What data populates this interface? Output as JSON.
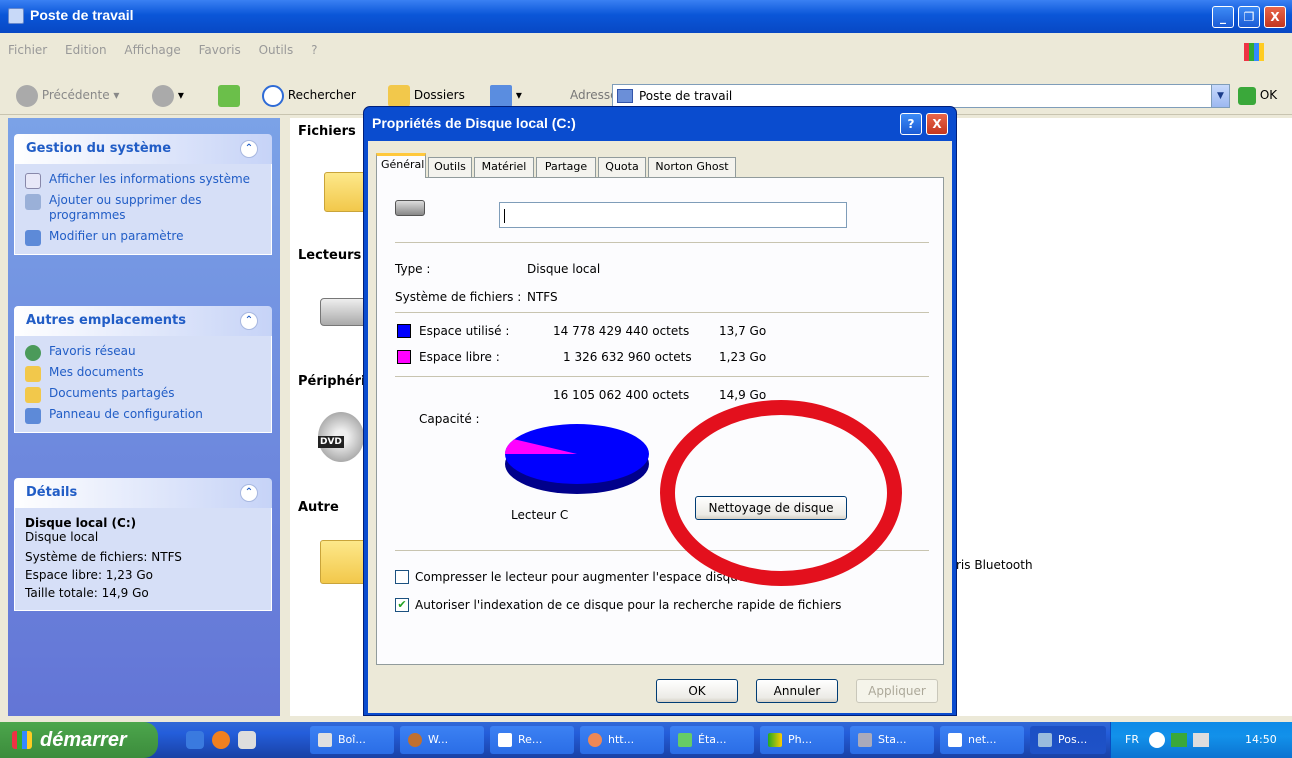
{
  "window": {
    "title": "Poste de travail",
    "minimize": "_",
    "restore": "❐",
    "close": "X"
  },
  "menu": [
    "Fichier",
    "Edition",
    "Affichage",
    "Favoris",
    "Outils",
    "?"
  ],
  "toolbar": {
    "back": "Précédente",
    "search": "Rechercher",
    "folders": "Dossiers",
    "address_label": "Adresse",
    "address_value": "Poste de travail",
    "go": "OK"
  },
  "left_panel": {
    "system": {
      "title": "Gestion du système",
      "items": [
        "Afficher les informations système",
        "Ajouter ou supprimer des programmes",
        "Modifier un paramètre"
      ]
    },
    "places": {
      "title": "Autres emplacements",
      "items": [
        "Favoris réseau",
        "Mes documents",
        "Documents partagés",
        "Panneau de configuration"
      ]
    },
    "details": {
      "title": "Détails",
      "name": "Disque local (C:)",
      "type": "Disque local",
      "fs": "Système de fichiers: NTFS",
      "free": "Espace libre: 1,23 Go",
      "total": "Taille totale: 14,9 Go"
    }
  },
  "content": {
    "sections": [
      "Fichiers",
      "Lecteurs",
      "Périphériques",
      "Autre"
    ],
    "bluetooth_label": "ris Bluetooth",
    "dvd_label": "DVD"
  },
  "dialog": {
    "title": "Propriétés de Disque local (C:)",
    "help": "?",
    "close": "X",
    "tabs": [
      "Général",
      "Outils",
      "Matériel",
      "Partage",
      "Quota",
      "Norton Ghost"
    ],
    "name_value": "",
    "type_label": "Type :",
    "type_value": "Disque local",
    "fs_label": "Système de fichiers :",
    "fs_value": "NTFS",
    "used_label": "Espace utilisé :",
    "used_bytes": "14 778 429 440 octets",
    "used_go": "13,7 Go",
    "free_label": "Espace libre :",
    "free_bytes": "1 326 632 960 octets",
    "free_go": "1,23 Go",
    "capacity_label": "Capacité :",
    "capacity_bytes": "16 105 062 400 octets",
    "capacity_go": "14,9 Go",
    "drive_label": "Lecteur C",
    "cleanup_button": "Nettoyage de disque",
    "compress_label": "Compresser le lecteur pour augmenter l'espace disque disponible",
    "index_label": "Autoriser l'indexation de ce disque pour la recherche rapide de fichiers",
    "compress_checked": false,
    "index_checked": true,
    "ok": "OK",
    "cancel": "Annuler",
    "apply": "Appliquer",
    "used_fraction": 0.918,
    "colors": {
      "used": "#0000ff",
      "free": "#ff00ff"
    }
  },
  "taskbar": {
    "start": "démarrer",
    "buttons": [
      "Boî...",
      "W...",
      "Re...",
      "htt...",
      "Éta...",
      "Ph...",
      "Sta...",
      "net...",
      "Pos..."
    ],
    "lang": "FR",
    "time": "14:50"
  }
}
